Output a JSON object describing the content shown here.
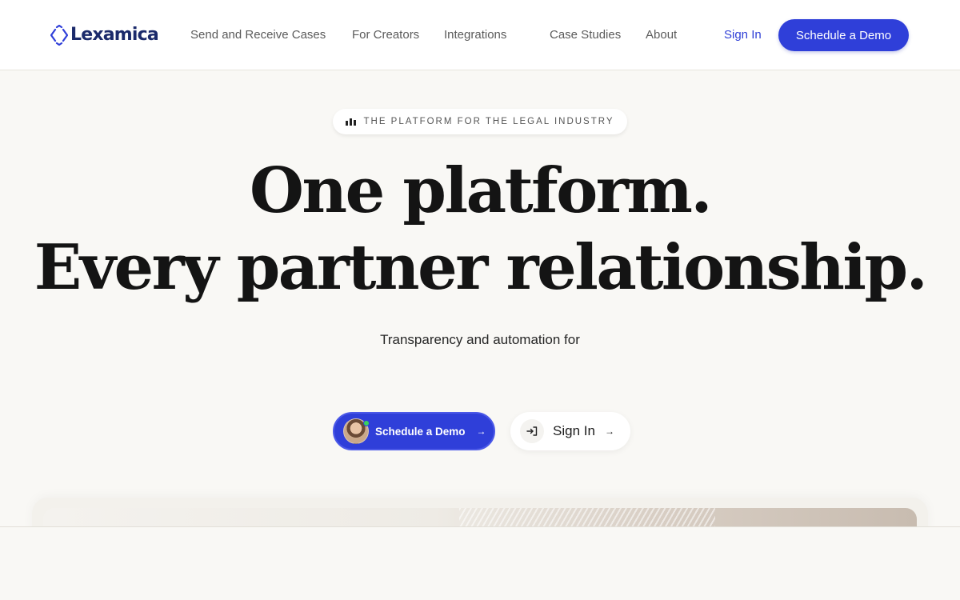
{
  "brand": {
    "name": "Lexamica",
    "accent": "#2f3fd9",
    "logo_color": "#1b2a6b"
  },
  "nav": {
    "links": [
      "Send and Receive Cases",
      "For Creators",
      "Integrations",
      "Case Studies",
      "About"
    ],
    "signin_label": "Sign In",
    "demo_label": "Schedule a Demo"
  },
  "hero": {
    "badge_icon": "bar-chart-icon",
    "badge": "THE PLATFORM FOR THE LEGAL INDUSTRY",
    "headline_line1": "One platform.",
    "headline_line2": "Every partner relationship.",
    "subheadline": "Transparency and automation for",
    "cta_primary": "Schedule a Demo",
    "cta_secondary": "Sign In",
    "cta_arrow": "→"
  }
}
